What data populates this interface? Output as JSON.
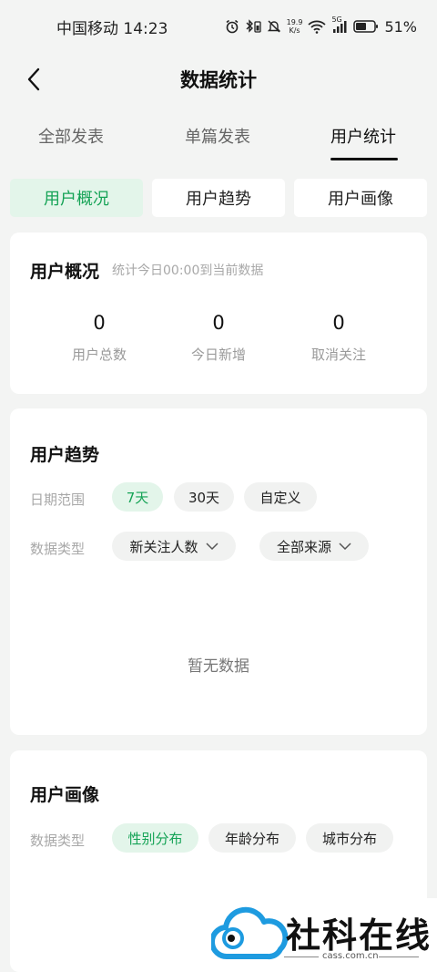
{
  "status": {
    "carrier_time": "中国移动 14:23",
    "speed_top": "19.9",
    "speed_bottom": "K/s",
    "signal": "5G",
    "battery": "51%"
  },
  "header": {
    "title": "数据统计"
  },
  "tabs": [
    {
      "label": "全部发表"
    },
    {
      "label": "单篇发表"
    },
    {
      "label": "用户统计"
    }
  ],
  "segments": [
    {
      "label": "用户概况"
    },
    {
      "label": "用户趋势"
    },
    {
      "label": "用户画像"
    }
  ],
  "overview": {
    "title": "用户概况",
    "subtitle": "统计今日00:00到当前数据",
    "stats": [
      {
        "value": "0",
        "label": "用户总数"
      },
      {
        "value": "0",
        "label": "今日新增"
      },
      {
        "value": "0",
        "label": "取消关注"
      }
    ]
  },
  "trend": {
    "title": "用户趋势",
    "date_label": "日期范围",
    "date_options": [
      "7天",
      "30天",
      "自定义"
    ],
    "type_label": "数据类型",
    "type_select": "新关注人数",
    "source_select": "全部来源",
    "empty": "暂无数据"
  },
  "portrait": {
    "title": "用户画像",
    "type_label": "数据类型",
    "options": [
      "性别分布",
      "年龄分布",
      "城市分布"
    ]
  },
  "watermark": {
    "text": "社科在线",
    "url": "cass.com.cn"
  },
  "colors": {
    "accent": "#15a356",
    "accent_bg": "#e3f5ea",
    "background": "#f3f4f3"
  }
}
